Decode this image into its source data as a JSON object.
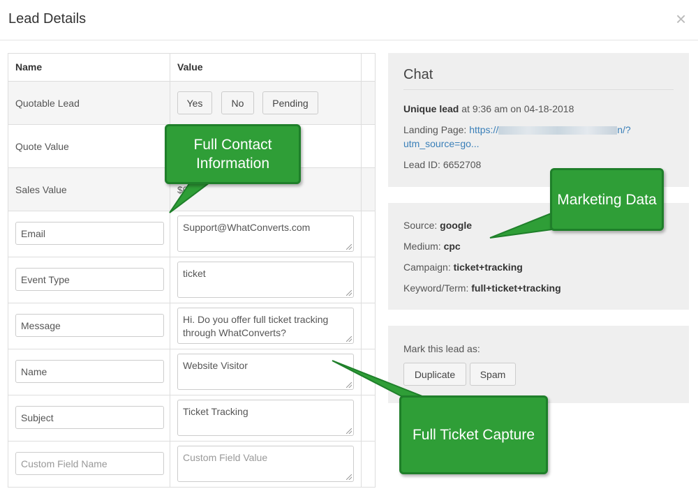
{
  "modal": {
    "title": "Lead Details",
    "close_glyph": "×"
  },
  "table": {
    "headers": {
      "name": "Name",
      "value": "Value"
    },
    "quotable": {
      "label": "Quotable Lead",
      "options": [
        "Yes",
        "No",
        "Pending"
      ]
    },
    "quote_value": {
      "label": "Quote Value"
    },
    "sales_value": {
      "label": "Sales Value",
      "value": "$0"
    },
    "fields": [
      {
        "name": "Email",
        "value": "Support@WhatConverts.com"
      },
      {
        "name": "Event Type",
        "value": "ticket"
      },
      {
        "name": "Message",
        "value": "Hi. Do you offer full ticket tracking through WhatConverts?"
      },
      {
        "name": "Name",
        "value": "Website Visitor"
      },
      {
        "name": "Subject",
        "value": "Ticket Tracking"
      }
    ],
    "custom": {
      "name_placeholder": "Custom Field Name",
      "value_placeholder": "Custom Field Value"
    }
  },
  "chat": {
    "title": "Chat",
    "unique_bold": "Unique lead",
    "unique_rest": " at 9:36 am on 04-18-2018",
    "landing_label": "Landing Page: ",
    "landing_start": "https://",
    "landing_end": "n/?",
    "landing_line2": "utm_source=go...",
    "lead_id": "Lead ID: 6652708"
  },
  "marketing": {
    "source_label": "Source: ",
    "source": "google",
    "medium_label": "Medium: ",
    "medium": "cpc",
    "campaign_label": "Campaign: ",
    "campaign": "ticket+tracking",
    "keyword_label": "Keyword/Term: ",
    "keyword": "full+ticket+tracking"
  },
  "mark": {
    "label": "Mark this lead as:",
    "duplicate": "Duplicate",
    "spam": "Spam"
  },
  "callouts": {
    "contact": "Full Contact Information",
    "marketing": "Marketing Data",
    "ticket": "Full Ticket Capture"
  },
  "colors": {
    "callout_green": "#2f9e37",
    "link_blue": "#3a7fb8"
  }
}
